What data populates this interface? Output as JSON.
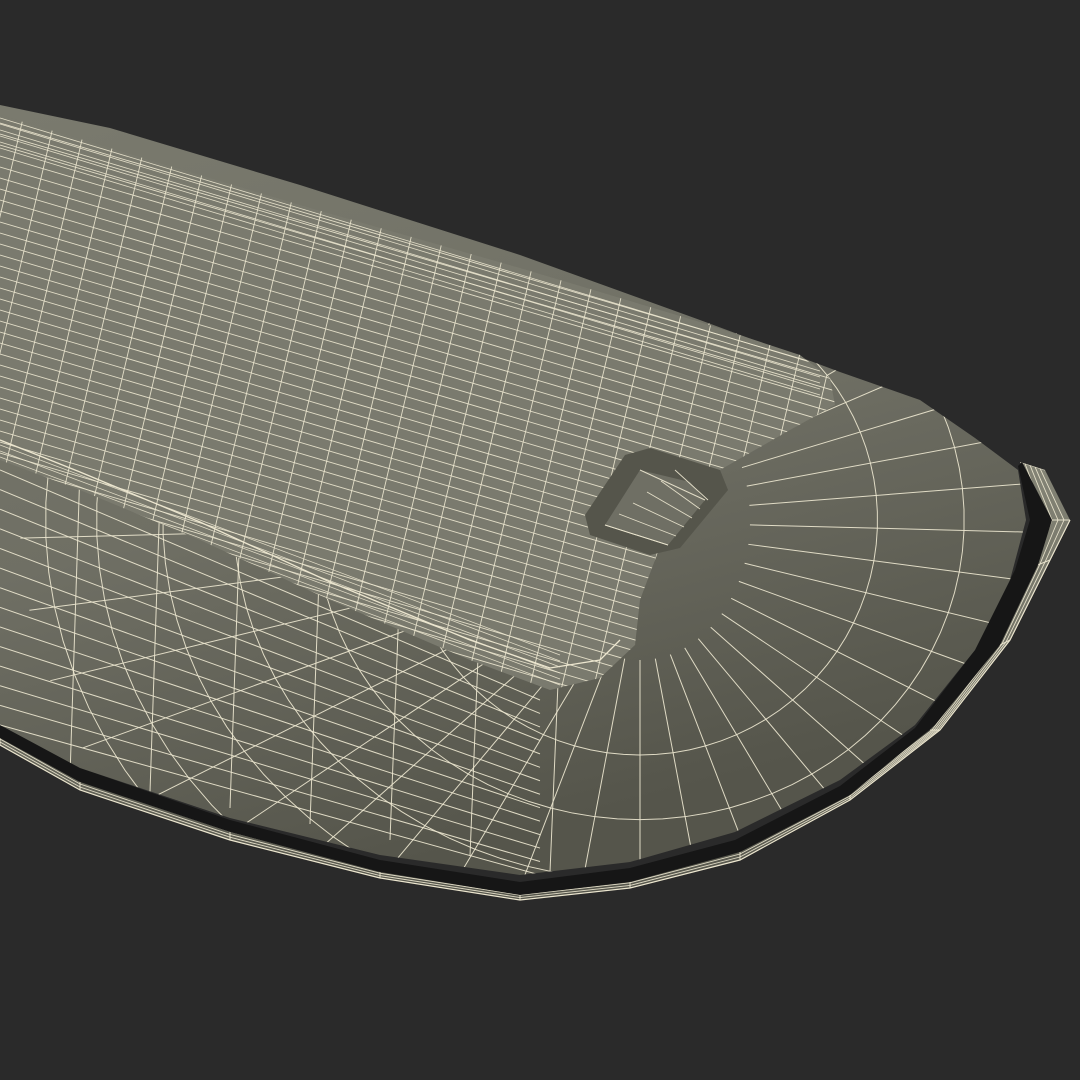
{
  "render": {
    "subject": "wireframe-3d-model",
    "view": "perspective",
    "colors": {
      "background": "#2a2a2a",
      "surface_top": "#7a7a6e",
      "surface_mid": "#6f6f64",
      "surface_dark": "#55554b",
      "rim": "#848476",
      "shadow": "#161616",
      "wire": "#ece6cf"
    }
  }
}
